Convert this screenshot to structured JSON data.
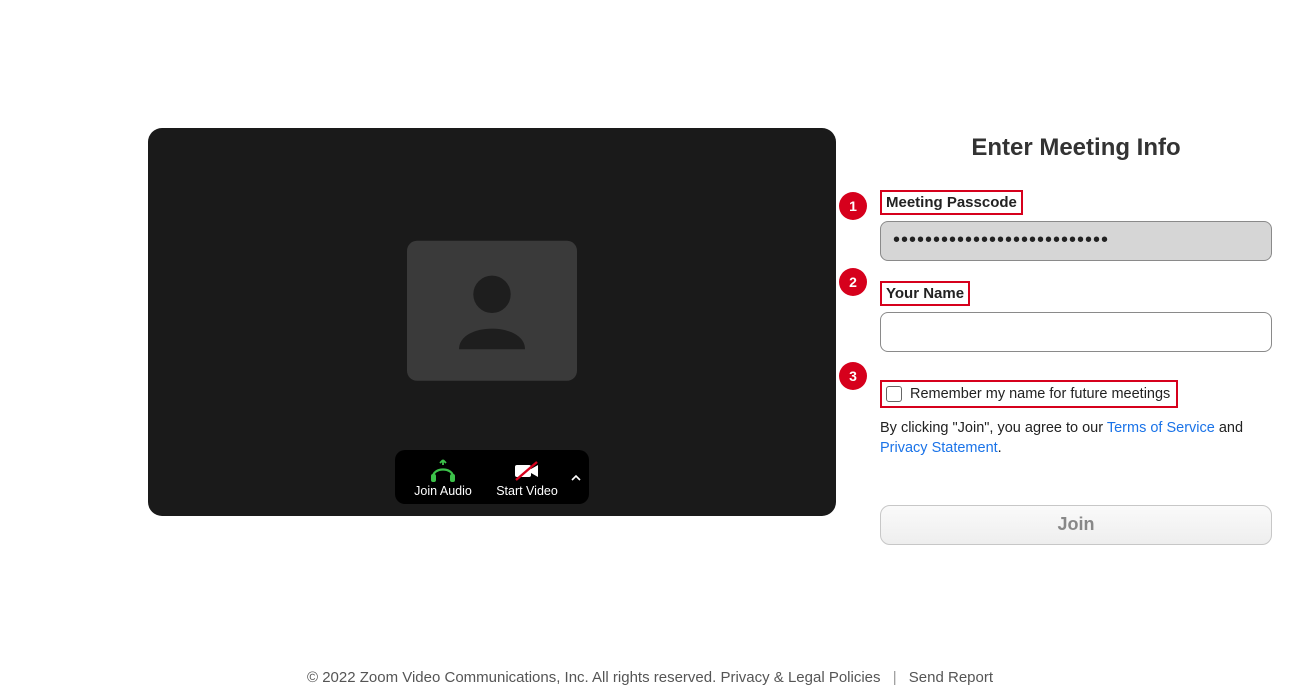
{
  "preview": {
    "join_audio_label": "Join Audio",
    "start_video_label": "Start Video"
  },
  "form": {
    "title": "Enter Meeting Info",
    "passcode_label": "Meeting Passcode",
    "passcode_value": "•••••••••••••••••••••••••••",
    "name_label": "Your Name",
    "name_value": "",
    "remember_label": "Remember my name for future meetings",
    "legal_prefix": "By clicking \"Join\", you agree to our ",
    "tos_label": "Terms of Service",
    "legal_and": " and ",
    "privacy_label": "Privacy Statement",
    "legal_suffix": ".",
    "join_button": "Join"
  },
  "annotations": {
    "badge1": "1",
    "badge2": "2",
    "badge3": "3"
  },
  "footer": {
    "copyright": "© 2022 Zoom Video Communications, Inc. All rights reserved.",
    "policies": "Privacy & Legal Policies",
    "separator": "|",
    "report": "Send Report"
  }
}
